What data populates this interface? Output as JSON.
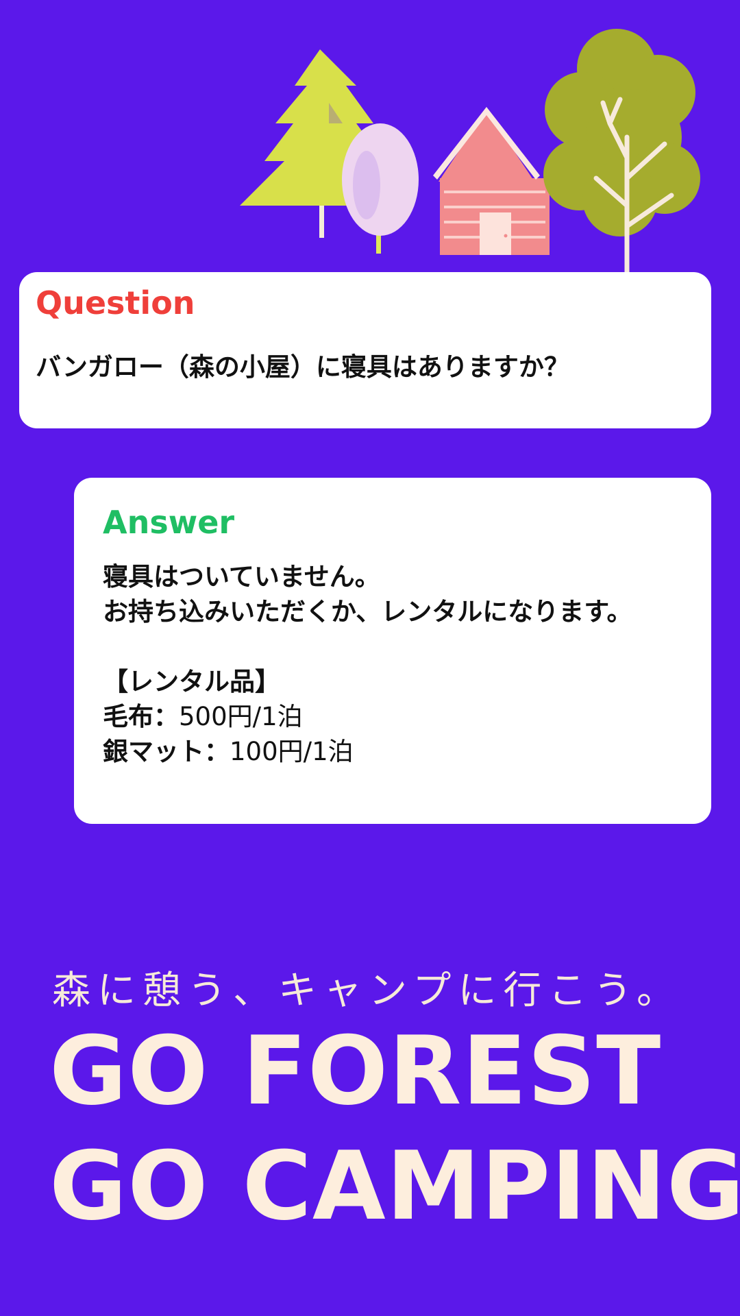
{
  "colors": {
    "background": "#5b18ea",
    "card": "#ffffff",
    "question_accent": "#ef3f3a",
    "answer_accent": "#1fbe63",
    "headline": "#fdeedd"
  },
  "illustration": {
    "icons": [
      "pine-tree-icon",
      "oval-tree-icon",
      "cabin-icon",
      "round-tree-icon"
    ]
  },
  "question": {
    "label": "Question",
    "text": "バンガロー（森の小屋）に寝具はありますか？"
  },
  "answer": {
    "label": "Answer",
    "line1": "寝具はついていません。",
    "line2": "お持ち込みいただくか、レンタルになります。",
    "rental_heading": "【レンタル品】",
    "items": [
      {
        "name": "毛布：",
        "price": "500円/1泊"
      },
      {
        "name": "銀マット：",
        "price": "100円/1泊"
      }
    ]
  },
  "footer": {
    "tagline": "森に憩う、キャンプに行こう。",
    "headline_line1": "GO FOREST",
    "headline_line2": "GO CAMPING"
  }
}
